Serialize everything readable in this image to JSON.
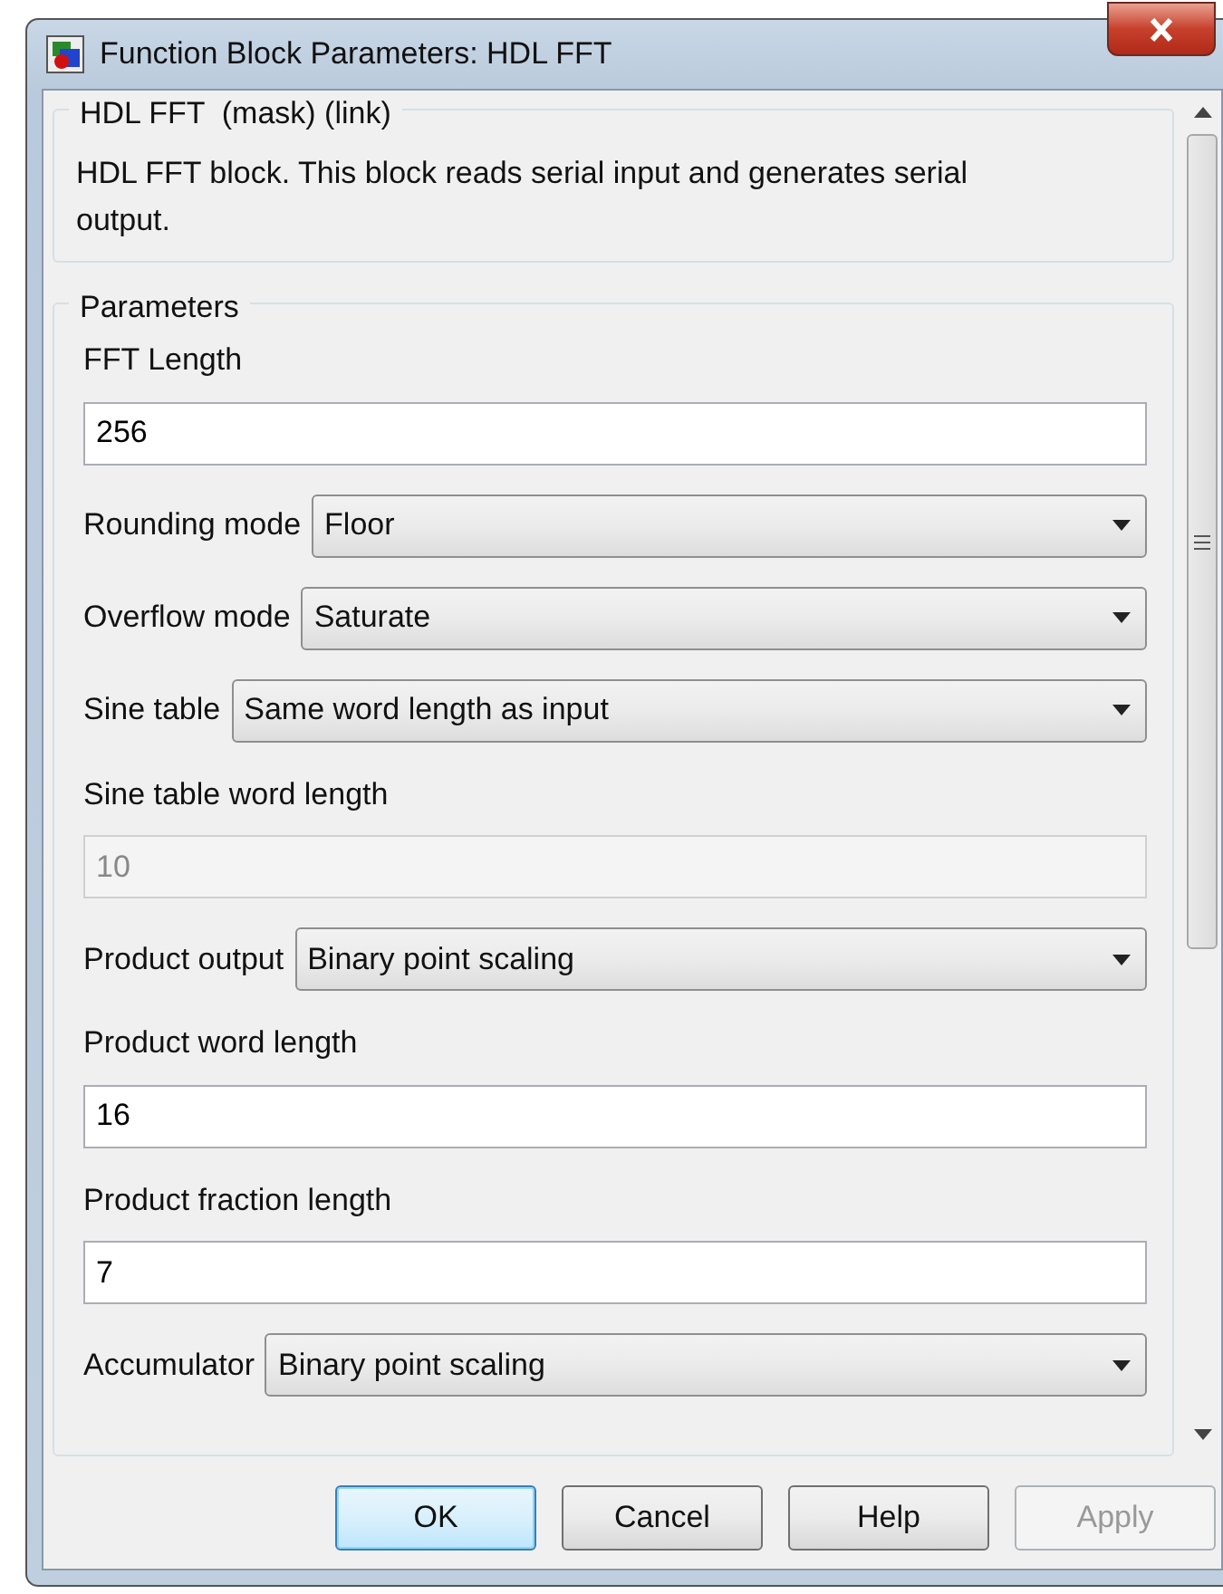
{
  "window": {
    "title": "Function Block Parameters: HDL FFT"
  },
  "description": {
    "title": "HDL FFT  (mask) (link)",
    "text": "HDL FFT block. This block reads serial input and generates serial output."
  },
  "parameters": {
    "title": "Parameters",
    "items": [
      {
        "kind": "text",
        "label": "FFT Length",
        "value": "256",
        "disabled": false
      },
      {
        "kind": "select",
        "label": "Rounding mode",
        "value": "Floor"
      },
      {
        "kind": "select",
        "label": "Overflow mode",
        "value": "Saturate"
      },
      {
        "kind": "select",
        "label": "Sine table",
        "value": "Same word length as input"
      },
      {
        "kind": "text",
        "label": "Sine table word length",
        "value": "10",
        "disabled": true
      },
      {
        "kind": "select",
        "label": "Product output",
        "value": "Binary point scaling"
      },
      {
        "kind": "text",
        "label": "Product word length",
        "value": "16",
        "disabled": false
      },
      {
        "kind": "text",
        "label": "Product fraction length",
        "value": "7",
        "disabled": false
      },
      {
        "kind": "select",
        "label": "Accumulator",
        "value": "Binary point scaling"
      }
    ]
  },
  "buttons": [
    {
      "label": "OK",
      "default": true,
      "disabled": false
    },
    {
      "label": "Cancel",
      "default": false,
      "disabled": false
    },
    {
      "label": "Help",
      "default": false,
      "disabled": false
    },
    {
      "label": "Apply",
      "default": false,
      "disabled": true
    }
  ]
}
